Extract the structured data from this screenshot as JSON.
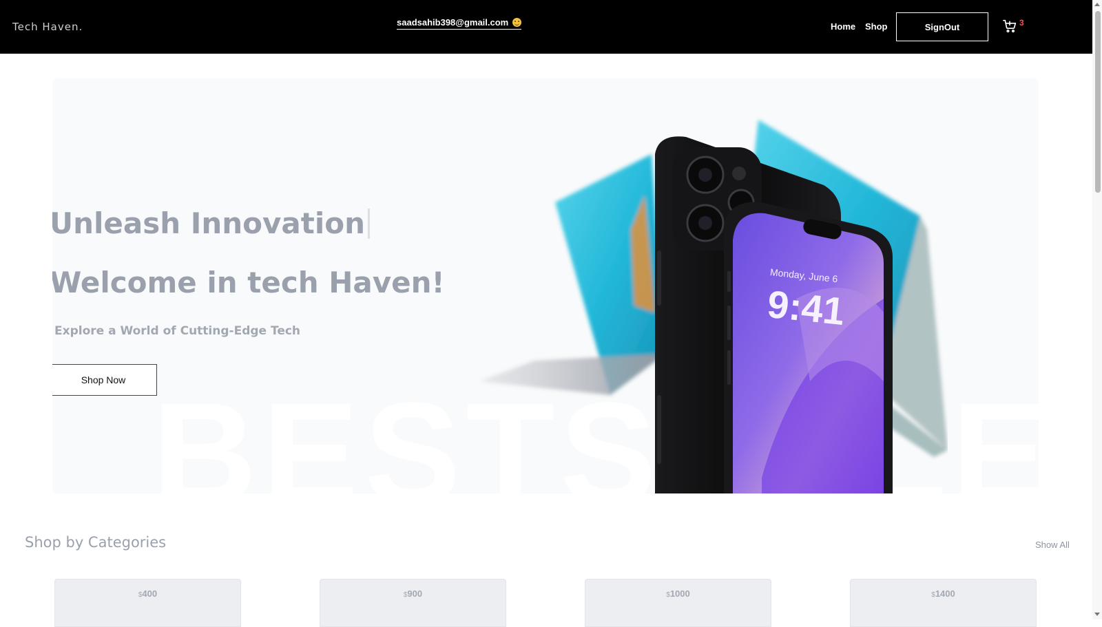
{
  "header": {
    "brand": "Tech Haven.",
    "user_email": "saadsahib398@gmail.com",
    "nav": {
      "home": "Home",
      "shop": "Shop",
      "signout": "SignOut"
    },
    "cart_count": "3",
    "cart_count_color": "#ff4d4d"
  },
  "hero": {
    "title": "Unleash Innovation",
    "subtitle": "Welcome in tech Haven!",
    "tagline": "Explore a World of Cutting-Edge Tech",
    "cta_label": "Shop Now",
    "background_text": "BESTSELLER",
    "phone_screen": {
      "date": "Monday, June 6",
      "time": "9:41"
    }
  },
  "categories": {
    "title": "Shop by Categories",
    "show_all": "Show All",
    "currency": "$",
    "items": [
      {
        "price": "400"
      },
      {
        "price": "900"
      },
      {
        "price": "1000"
      },
      {
        "price": "1400"
      }
    ]
  },
  "icons": {
    "cart": "cart-icon",
    "emoji": "smile-icon"
  }
}
